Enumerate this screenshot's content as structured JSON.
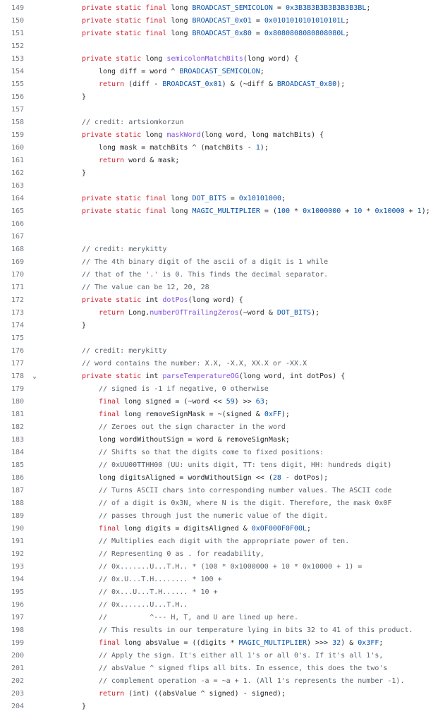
{
  "editor": {
    "lines": [
      {
        "n": "149",
        "indent": 0,
        "tokens": [
          [
            "kw",
            "private static final "
          ],
          [
            "pl",
            "long "
          ],
          [
            "const",
            "BROADCAST_SEMICOLON"
          ],
          [
            "pl",
            " = "
          ],
          [
            "num",
            "0x3B3B3B3B3B3B3B3BL"
          ],
          [
            "pl",
            ";"
          ]
        ]
      },
      {
        "n": "150",
        "indent": 0,
        "tokens": [
          [
            "kw",
            "private static final "
          ],
          [
            "pl",
            "long "
          ],
          [
            "const",
            "BROADCAST_0x01"
          ],
          [
            "pl",
            " = "
          ],
          [
            "num",
            "0x0101010101010101L"
          ],
          [
            "pl",
            ";"
          ]
        ]
      },
      {
        "n": "151",
        "indent": 0,
        "tokens": [
          [
            "kw",
            "private static final "
          ],
          [
            "pl",
            "long "
          ],
          [
            "const",
            "BROADCAST_0x80"
          ],
          [
            "pl",
            " = "
          ],
          [
            "num",
            "0x8080808080808080L"
          ],
          [
            "pl",
            ";"
          ]
        ]
      },
      {
        "n": "152",
        "indent": 0,
        "tokens": []
      },
      {
        "n": "153",
        "indent": 0,
        "tokens": [
          [
            "kw",
            "private static "
          ],
          [
            "pl",
            "long "
          ],
          [
            "fn",
            "semicolonMatchBits"
          ],
          [
            "pl",
            "(long word) {"
          ]
        ]
      },
      {
        "n": "154",
        "indent": 1,
        "tokens": [
          [
            "pl",
            "long diff = word ^ "
          ],
          [
            "const",
            "BROADCAST_SEMICOLON"
          ],
          [
            "pl",
            ";"
          ]
        ]
      },
      {
        "n": "155",
        "indent": 1,
        "tokens": [
          [
            "kw",
            "return "
          ],
          [
            "pl",
            "(diff - "
          ],
          [
            "const",
            "BROADCAST_0x01"
          ],
          [
            "pl",
            ") & (~diff & "
          ],
          [
            "const",
            "BROADCAST_0x80"
          ],
          [
            "pl",
            ");"
          ]
        ]
      },
      {
        "n": "156",
        "indent": 0,
        "tokens": [
          [
            "pl",
            "}"
          ]
        ]
      },
      {
        "n": "157",
        "indent": 0,
        "tokens": []
      },
      {
        "n": "158",
        "indent": 0,
        "tokens": [
          [
            "cm",
            "// credit: artsiomkorzun"
          ]
        ]
      },
      {
        "n": "159",
        "indent": 0,
        "tokens": [
          [
            "kw",
            "private static "
          ],
          [
            "pl",
            "long "
          ],
          [
            "fn",
            "maskWord"
          ],
          [
            "pl",
            "(long word, long matchBits) {"
          ]
        ]
      },
      {
        "n": "160",
        "indent": 1,
        "tokens": [
          [
            "pl",
            "long mask = matchBits ^ (matchBits - "
          ],
          [
            "num",
            "1"
          ],
          [
            "pl",
            ");"
          ]
        ]
      },
      {
        "n": "161",
        "indent": 1,
        "tokens": [
          [
            "kw",
            "return "
          ],
          [
            "pl",
            "word & mask;"
          ]
        ]
      },
      {
        "n": "162",
        "indent": 0,
        "tokens": [
          [
            "pl",
            "}"
          ]
        ]
      },
      {
        "n": "163",
        "indent": 0,
        "tokens": []
      },
      {
        "n": "164",
        "indent": 0,
        "tokens": [
          [
            "kw",
            "private static final "
          ],
          [
            "pl",
            "long "
          ],
          [
            "const",
            "DOT_BITS"
          ],
          [
            "pl",
            " = "
          ],
          [
            "num",
            "0x10101000"
          ],
          [
            "pl",
            ";"
          ]
        ]
      },
      {
        "n": "165",
        "indent": 0,
        "tokens": [
          [
            "kw",
            "private static final "
          ],
          [
            "pl",
            "long "
          ],
          [
            "const",
            "MAGIC_MULTIPLIER"
          ],
          [
            "pl",
            " = ("
          ],
          [
            "num",
            "100"
          ],
          [
            "pl",
            " * "
          ],
          [
            "num",
            "0x1000000"
          ],
          [
            "pl",
            " + "
          ],
          [
            "num",
            "10"
          ],
          [
            "pl",
            " * "
          ],
          [
            "num",
            "0x10000"
          ],
          [
            "pl",
            " + "
          ],
          [
            "num",
            "1"
          ],
          [
            "pl",
            ");"
          ]
        ]
      },
      {
        "n": "166",
        "indent": 0,
        "tokens": []
      },
      {
        "n": "167",
        "indent": 0,
        "tokens": []
      },
      {
        "n": "168",
        "indent": 0,
        "tokens": [
          [
            "cm",
            "// credit: merykitty"
          ]
        ]
      },
      {
        "n": "169",
        "indent": 0,
        "tokens": [
          [
            "cm",
            "// The 4th binary digit of the ascii of a digit is 1 while"
          ]
        ]
      },
      {
        "n": "170",
        "indent": 0,
        "tokens": [
          [
            "cm",
            "// that of the '.' is 0. This finds the decimal separator."
          ]
        ]
      },
      {
        "n": "171",
        "indent": 0,
        "tokens": [
          [
            "cm",
            "// The value can be 12, 20, 28"
          ]
        ]
      },
      {
        "n": "172",
        "indent": 0,
        "tokens": [
          [
            "kw",
            "private static "
          ],
          [
            "pl",
            "int "
          ],
          [
            "fn",
            "dotPos"
          ],
          [
            "pl",
            "(long word) {"
          ]
        ]
      },
      {
        "n": "173",
        "indent": 1,
        "tokens": [
          [
            "kw",
            "return "
          ],
          [
            "pl",
            "Long."
          ],
          [
            "fn",
            "numberOfTrailingZeros"
          ],
          [
            "pl",
            "(~word & "
          ],
          [
            "const",
            "DOT_BITS"
          ],
          [
            "pl",
            ");"
          ]
        ]
      },
      {
        "n": "174",
        "indent": 0,
        "tokens": [
          [
            "pl",
            "}"
          ]
        ]
      },
      {
        "n": "175",
        "indent": 0,
        "tokens": []
      },
      {
        "n": "176",
        "indent": 0,
        "tokens": [
          [
            "cm",
            "// credit: merykitty"
          ]
        ]
      },
      {
        "n": "177",
        "indent": 0,
        "tokens": [
          [
            "cm",
            "// word contains the number: X.X, -X.X, XX.X or -XX.X"
          ]
        ]
      },
      {
        "n": "178",
        "indent": 0,
        "fold": true,
        "tokens": [
          [
            "kw",
            "private static "
          ],
          [
            "pl",
            "int "
          ],
          [
            "fn",
            "parseTemperatureOG"
          ],
          [
            "pl",
            "(long word, int dotPos) {"
          ]
        ]
      },
      {
        "n": "179",
        "indent": 1,
        "tokens": [
          [
            "cm",
            "// signed is -1 if negative, 0 otherwise"
          ]
        ]
      },
      {
        "n": "180",
        "indent": 1,
        "tokens": [
          [
            "kw",
            "final "
          ],
          [
            "pl",
            "long signed = (~word << "
          ],
          [
            "num",
            "59"
          ],
          [
            "pl",
            ") >> "
          ],
          [
            "num",
            "63"
          ],
          [
            "pl",
            ";"
          ]
        ]
      },
      {
        "n": "181",
        "indent": 1,
        "tokens": [
          [
            "kw",
            "final "
          ],
          [
            "pl",
            "long removeSignMask = ~(signed & "
          ],
          [
            "num",
            "0xFF"
          ],
          [
            "pl",
            ");"
          ]
        ]
      },
      {
        "n": "182",
        "indent": 1,
        "tokens": [
          [
            "cm",
            "// Zeroes out the sign character in the word"
          ]
        ]
      },
      {
        "n": "183",
        "indent": 1,
        "tokens": [
          [
            "pl",
            "long wordWithoutSign = word & removeSignMask;"
          ]
        ]
      },
      {
        "n": "184",
        "indent": 1,
        "tokens": [
          [
            "cm",
            "// Shifts so that the digits come to fixed positions:"
          ]
        ]
      },
      {
        "n": "185",
        "indent": 1,
        "tokens": [
          [
            "cm",
            "// 0xUU00TTHH00 (UU: units digit, TT: tens digit, HH: hundreds digit)"
          ]
        ]
      },
      {
        "n": "186",
        "indent": 1,
        "tokens": [
          [
            "pl",
            "long digitsAligned = wordWithoutSign << ("
          ],
          [
            "num",
            "28"
          ],
          [
            "pl",
            " - dotPos);"
          ]
        ]
      },
      {
        "n": "187",
        "indent": 1,
        "tokens": [
          [
            "cm",
            "// Turns ASCII chars into corresponding number values. The ASCII code"
          ]
        ]
      },
      {
        "n": "188",
        "indent": 1,
        "tokens": [
          [
            "cm",
            "// of a digit is 0x3N, where N is the digit. Therefore, the mask 0x0F"
          ]
        ]
      },
      {
        "n": "189",
        "indent": 1,
        "tokens": [
          [
            "cm",
            "// passes through just the numeric value of the digit."
          ]
        ]
      },
      {
        "n": "190",
        "indent": 1,
        "tokens": [
          [
            "kw",
            "final "
          ],
          [
            "pl",
            "long digits = digitsAligned & "
          ],
          [
            "num",
            "0x0F000F0F00L"
          ],
          [
            "pl",
            ";"
          ]
        ]
      },
      {
        "n": "191",
        "indent": 1,
        "tokens": [
          [
            "cm",
            "// Multiplies each digit with the appropriate power of ten."
          ]
        ]
      },
      {
        "n": "192",
        "indent": 1,
        "tokens": [
          [
            "cm",
            "// Representing 0 as . for readability,"
          ]
        ]
      },
      {
        "n": "193",
        "indent": 1,
        "tokens": [
          [
            "cm",
            "// 0x.......U...T.H.. * (100 * 0x1000000 + 10 * 0x10000 + 1) ="
          ]
        ]
      },
      {
        "n": "194",
        "indent": 1,
        "tokens": [
          [
            "cm",
            "// 0x.U...T.H........ * 100 +"
          ]
        ]
      },
      {
        "n": "195",
        "indent": 1,
        "tokens": [
          [
            "cm",
            "// 0x...U...T.H...... * 10 +"
          ]
        ]
      },
      {
        "n": "196",
        "indent": 1,
        "tokens": [
          [
            "cm",
            "// 0x.......U...T.H.."
          ]
        ]
      },
      {
        "n": "197",
        "indent": 1,
        "tokens": [
          [
            "cm",
            "//          ^--- H, T, and U are lined up here."
          ]
        ]
      },
      {
        "n": "198",
        "indent": 1,
        "tokens": [
          [
            "cm",
            "// This results in our temperature lying in bits 32 to 41 of this product."
          ]
        ]
      },
      {
        "n": "199",
        "indent": 1,
        "tokens": [
          [
            "kw",
            "final "
          ],
          [
            "pl",
            "long absValue = ((digits * "
          ],
          [
            "const",
            "MAGIC_MULTIPLIER"
          ],
          [
            "pl",
            ") >>> "
          ],
          [
            "num",
            "32"
          ],
          [
            "pl",
            ") & "
          ],
          [
            "num",
            "0x3FF"
          ],
          [
            "pl",
            ";"
          ]
        ]
      },
      {
        "n": "200",
        "indent": 1,
        "tokens": [
          [
            "cm",
            "// Apply the sign. It's either all 1's or all 0's. If it's all 1's,"
          ]
        ]
      },
      {
        "n": "201",
        "indent": 1,
        "tokens": [
          [
            "cm",
            "// absValue ^ signed flips all bits. In essence, this does the two's"
          ]
        ]
      },
      {
        "n": "202",
        "indent": 1,
        "tokens": [
          [
            "cm",
            "// complement operation -a = ~a + 1. (All 1's represents the number -1)."
          ]
        ]
      },
      {
        "n": "203",
        "indent": 1,
        "tokens": [
          [
            "kw",
            "return "
          ],
          [
            "pl",
            "(int) ((absValue ^ signed) - signed);"
          ]
        ]
      },
      {
        "n": "204",
        "indent": 0,
        "tokens": [
          [
            "pl",
            "}"
          ]
        ]
      }
    ]
  },
  "icons": {
    "fold": "chevron-down-icon",
    "fold_glyph": "⌄"
  },
  "colors": {
    "keyword": "#cf222e",
    "constant": "#0550ae",
    "number": "#0550ae",
    "function": "#8250df",
    "comment": "#57606a",
    "plain": "#1f2328",
    "line_number": "#6e7781",
    "background": "#ffffff"
  }
}
